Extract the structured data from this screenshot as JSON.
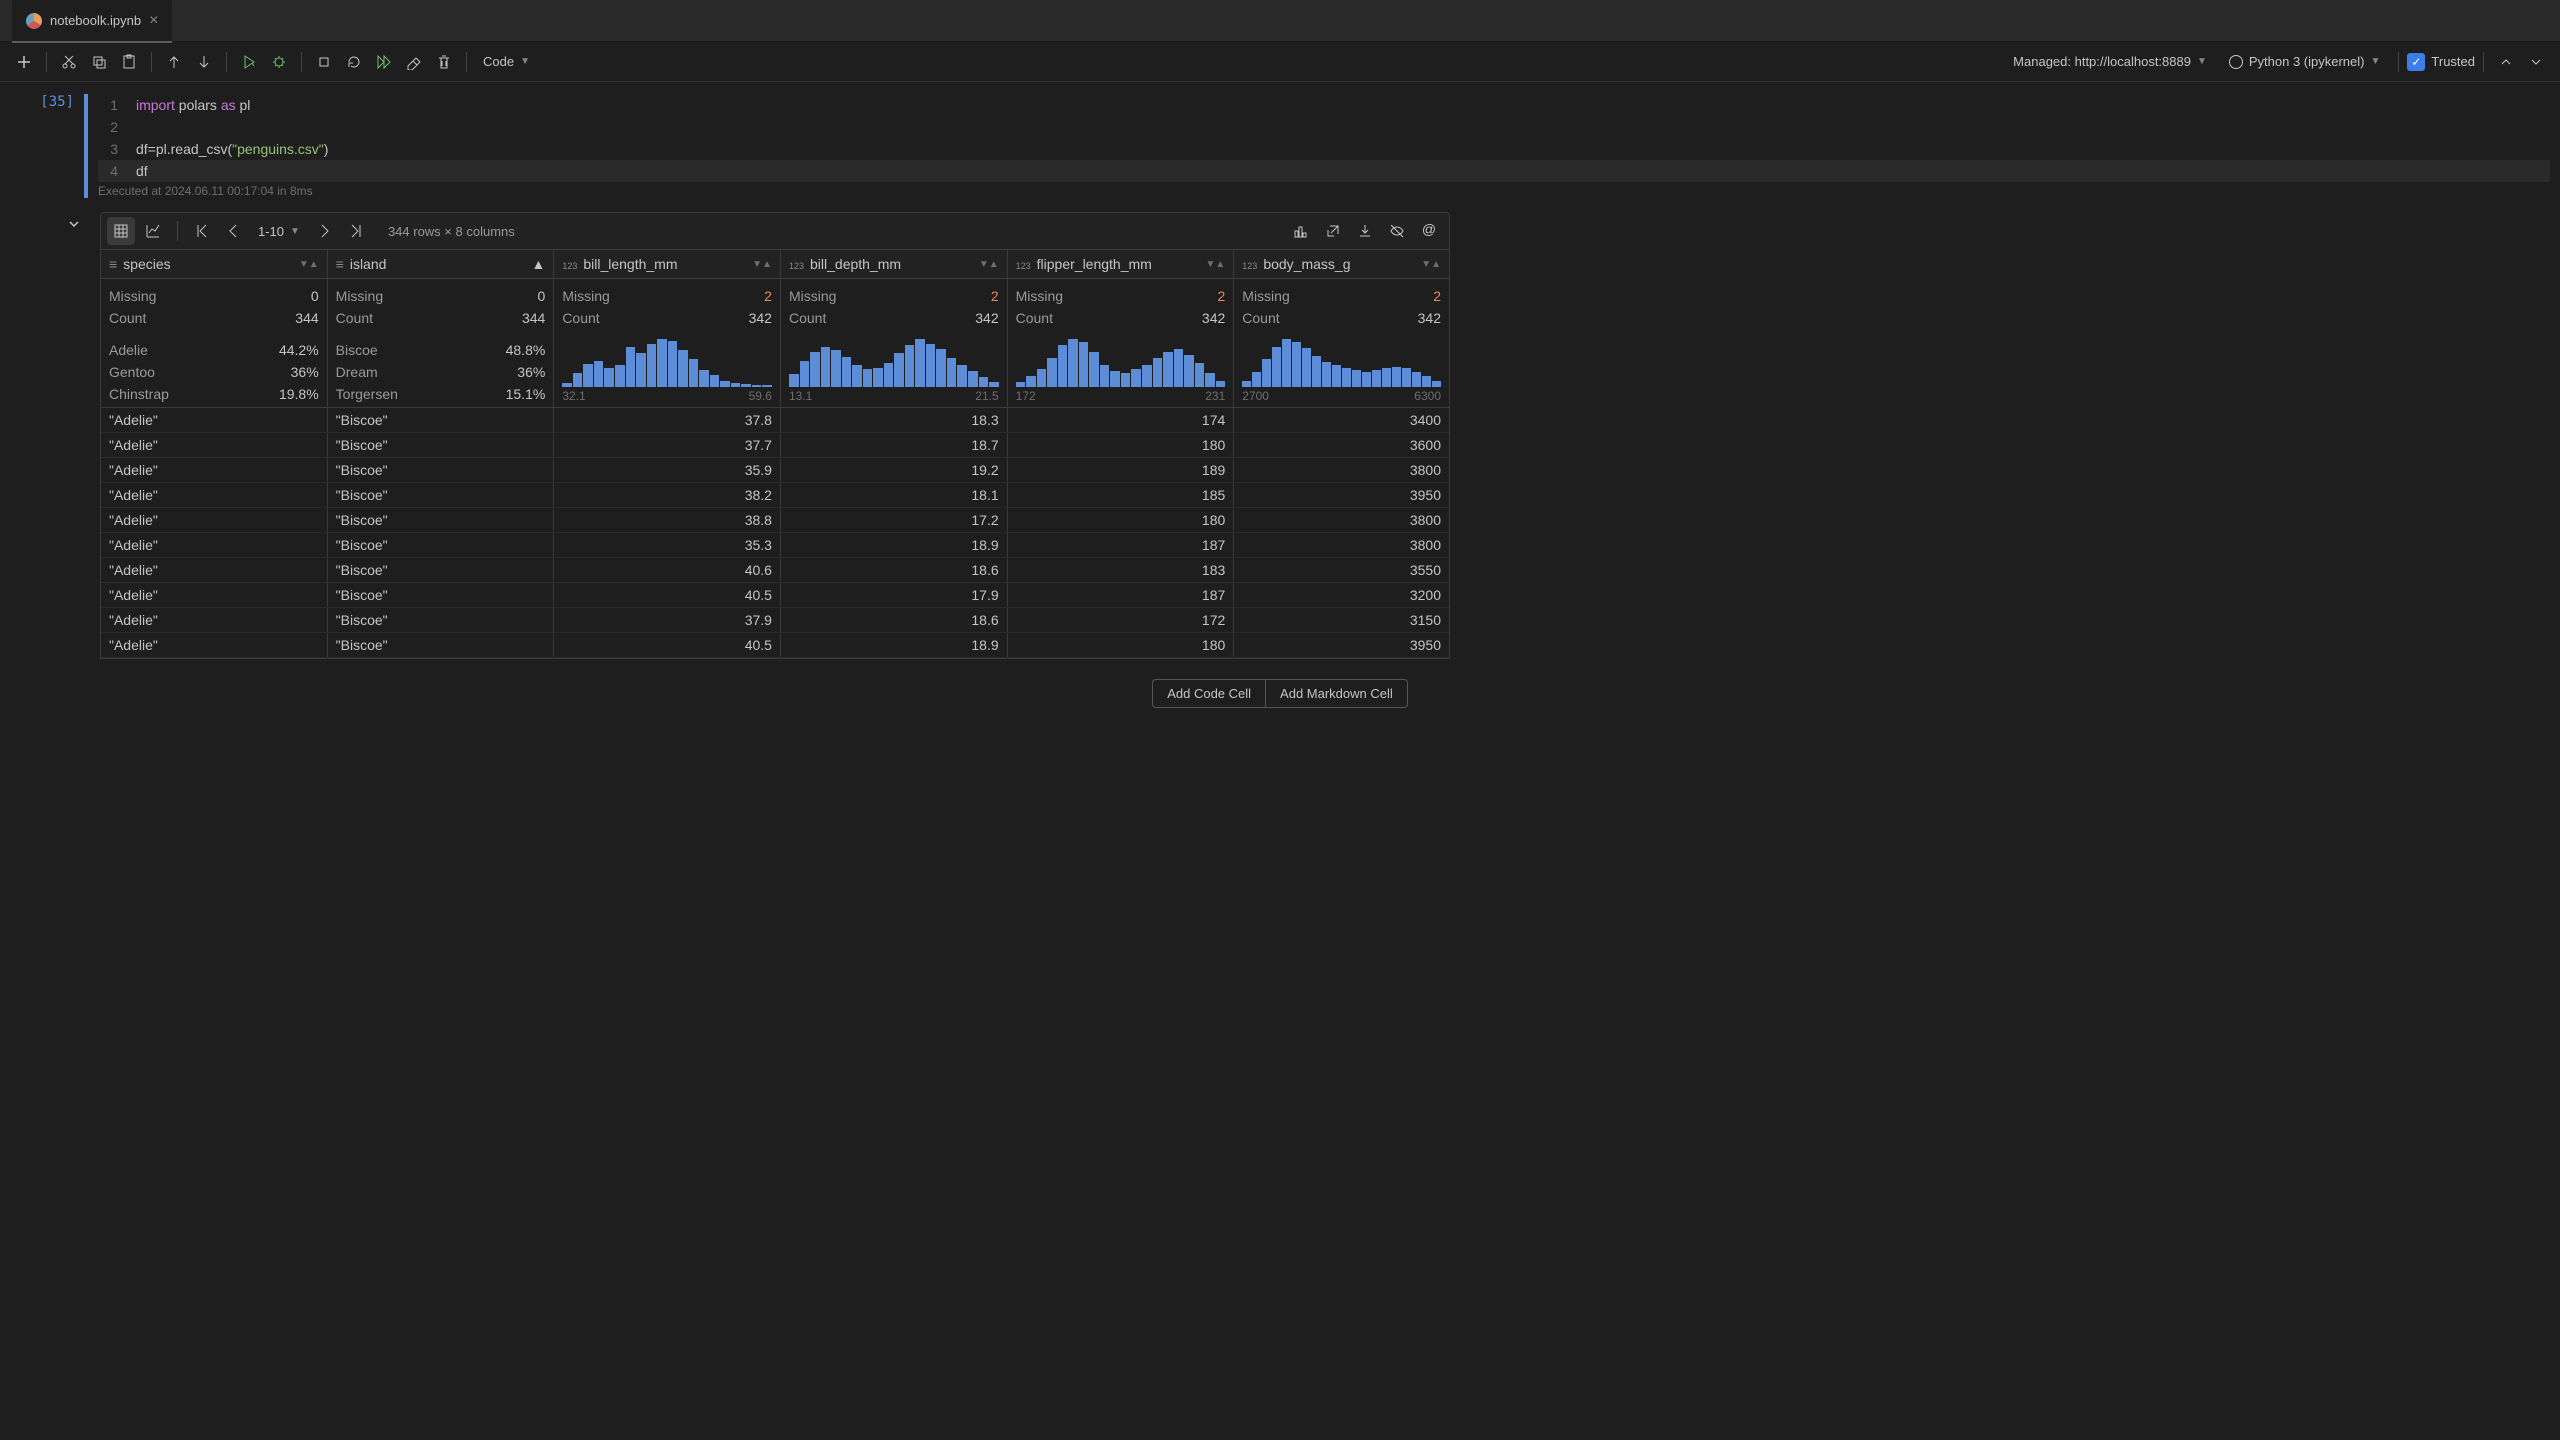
{
  "tab": {
    "filename": "noteboolk.ipynb"
  },
  "toolbar": {
    "cell_type": "Code",
    "managed": "Managed: http://localhost:8889",
    "kernel": "Python 3 (ipykernel)",
    "trusted": "Trusted"
  },
  "cell": {
    "exec_count": "[35]",
    "lines": [
      {
        "n": "1",
        "code_html": "<span class='kw'>import</span> polars <span class='kw'>as</span> pl"
      },
      {
        "n": "2",
        "code_html": ""
      },
      {
        "n": "3",
        "code_html": "df=pl.read_csv(<span class='str'>\"penguins.csv\"</span>)"
      },
      {
        "n": "4",
        "code_html": "df",
        "current": true
      }
    ],
    "exec_meta": "Executed at 2024.06.11 00:17:04 in 8ms"
  },
  "output": {
    "page_range": "1-10",
    "shape": "344 rows × 8 columns",
    "columns": [
      {
        "name": "species",
        "type": "str",
        "missing": "0",
        "count": "344",
        "categories": [
          {
            "label": "Adelie",
            "pct": "44.2%"
          },
          {
            "label": "Gentoo",
            "pct": "36%"
          },
          {
            "label": "Chinstrap",
            "pct": "19.8%"
          }
        ]
      },
      {
        "name": "island",
        "type": "str",
        "sorted": "asc",
        "missing": "0",
        "count": "344",
        "categories": [
          {
            "label": "Biscoe",
            "pct": "48.8%"
          },
          {
            "label": "Dream",
            "pct": "36%"
          },
          {
            "label": "Torgersen",
            "pct": "15.1%"
          }
        ]
      },
      {
        "name": "bill_length_mm",
        "type": "num",
        "missing": "2",
        "count": "342",
        "range": [
          "32.1",
          "59.6"
        ],
        "histo": [
          5,
          18,
          30,
          34,
          25,
          28,
          52,
          44,
          56,
          62,
          60,
          48,
          36,
          22,
          16,
          8,
          5,
          4,
          2,
          2
        ]
      },
      {
        "name": "bill_depth_mm",
        "type": "num",
        "missing": "2",
        "count": "342",
        "range": [
          "13.1",
          "21.5"
        ],
        "histo": [
          16,
          32,
          44,
          50,
          46,
          38,
          28,
          22,
          24,
          30,
          42,
          52,
          60,
          54,
          48,
          36,
          28,
          20,
          12,
          6
        ]
      },
      {
        "name": "flipper_length_mm",
        "type": "num",
        "missing": "2",
        "count": "342",
        "range": [
          "172",
          "231"
        ],
        "histo": [
          6,
          14,
          22,
          36,
          52,
          60,
          56,
          44,
          28,
          20,
          18,
          22,
          28,
          36,
          44,
          48,
          40,
          30,
          18,
          8
        ]
      },
      {
        "name": "body_mass_g",
        "type": "num",
        "missing": "2",
        "count": "342",
        "range": [
          "2700",
          "6300"
        ],
        "histo": [
          8,
          20,
          36,
          52,
          62,
          58,
          50,
          40,
          32,
          28,
          24,
          22,
          20,
          22,
          24,
          26,
          24,
          20,
          14,
          8
        ]
      }
    ],
    "rows": [
      [
        "\"Adelie\"",
        "\"Biscoe\"",
        "37.8",
        "18.3",
        "174",
        "3400"
      ],
      [
        "\"Adelie\"",
        "\"Biscoe\"",
        "37.7",
        "18.7",
        "180",
        "3600"
      ],
      [
        "\"Adelie\"",
        "\"Biscoe\"",
        "35.9",
        "19.2",
        "189",
        "3800"
      ],
      [
        "\"Adelie\"",
        "\"Biscoe\"",
        "38.2",
        "18.1",
        "185",
        "3950"
      ],
      [
        "\"Adelie\"",
        "\"Biscoe\"",
        "38.8",
        "17.2",
        "180",
        "3800"
      ],
      [
        "\"Adelie\"",
        "\"Biscoe\"",
        "35.3",
        "18.9",
        "187",
        "3800"
      ],
      [
        "\"Adelie\"",
        "\"Biscoe\"",
        "40.6",
        "18.6",
        "183",
        "3550"
      ],
      [
        "\"Adelie\"",
        "\"Biscoe\"",
        "40.5",
        "17.9",
        "187",
        "3200"
      ],
      [
        "\"Adelie\"",
        "\"Biscoe\"",
        "37.9",
        "18.6",
        "172",
        "3150"
      ],
      [
        "\"Adelie\"",
        "\"Biscoe\"",
        "40.5",
        "18.9",
        "180",
        "3950"
      ]
    ]
  },
  "buttons": {
    "add_code": "Add Code Cell",
    "add_md": "Add Markdown Cell"
  },
  "chart_data": {
    "type": "table",
    "title": "penguins dataframe preview",
    "columns": [
      "species",
      "island",
      "bill_length_mm",
      "bill_depth_mm",
      "flipper_length_mm",
      "body_mass_g"
    ],
    "shape": "344 rows × 8 columns",
    "rows_shown": 10,
    "histograms": [
      {
        "column": "bill_length_mm",
        "min": 32.1,
        "max": 59.6
      },
      {
        "column": "bill_depth_mm",
        "min": 13.1,
        "max": 21.5
      },
      {
        "column": "flipper_length_mm",
        "min": 172,
        "max": 231
      },
      {
        "column": "body_mass_g",
        "min": 2700,
        "max": 6300
      }
    ]
  }
}
